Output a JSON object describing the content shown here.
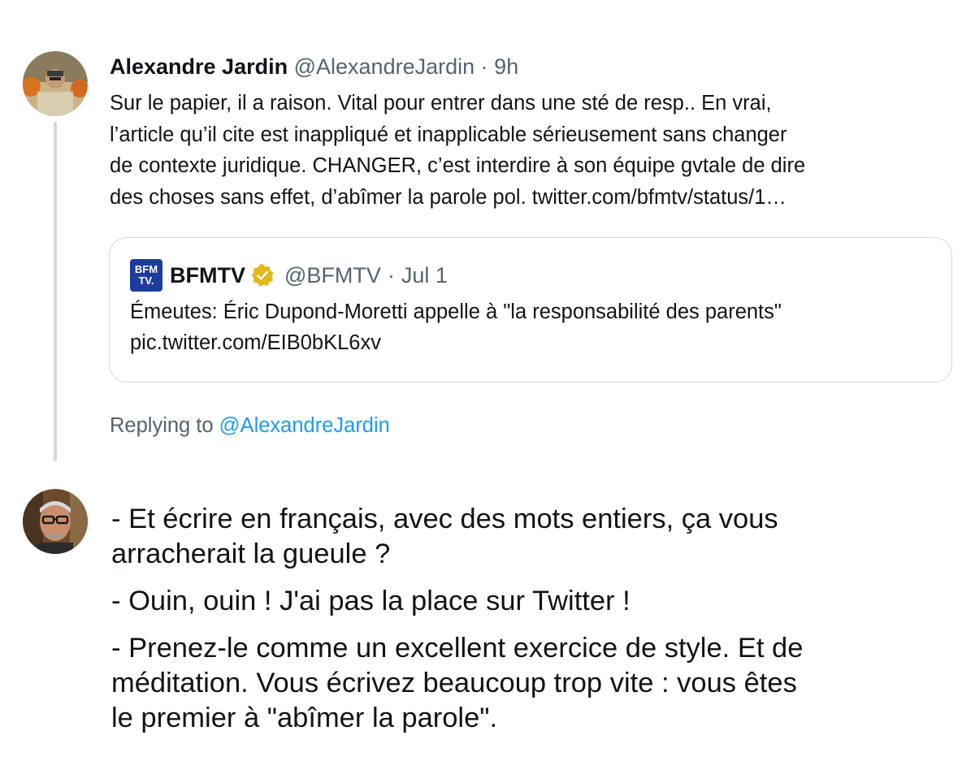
{
  "original_tweet": {
    "author_name": "Alexandre Jardin",
    "handle": "@AlexandreJardin",
    "separator": "·",
    "time": "9h",
    "avatar_icon": "user-photo-avatar",
    "text_lines": [
      "Sur le papier, il a raison. Vital pour entrer dans une sté de resp.. En vrai,",
      "l’article qu’il cite est inappliqué et inapplicable sérieusement sans changer",
      "de contexte juridique. CHANGER, c’est interdire à son équipe gvtale de dire",
      "des choses sans effet, d’abîmer la parole pol. twitter.com/bfmtv/status/1…"
    ]
  },
  "quoted_tweet": {
    "logo_text": [
      "BFM",
      "TV."
    ],
    "author_name": "BFMTV",
    "verified_icon": "gold-verified-badge-icon",
    "handle": "@BFMTV",
    "separator": "·",
    "time": "Jul 1",
    "text_lines": [
      "Émeutes: Éric Dupond-Moretti appelle à \"la responsabilité des parents\"",
      "pic.twitter.com/EIB0bKL6xv"
    ]
  },
  "replying_to": {
    "prefix": "Replying to",
    "mention": "@AlexandreJardin"
  },
  "reply": {
    "avatar_icon": "user-photo-avatar",
    "paragraphs": [
      [
        "- Et écrire en français, avec des mots entiers, ça vous",
        "arracherait la gueule ?"
      ],
      [
        "- Ouin, ouin ! J'ai pas la place sur Twitter !"
      ],
      [
        "- Prenez-le comme un excellent exercice de style. Et de",
        "méditation. Vous écrivez beaucoup trop vite : vous êtes",
        "le premier à \"abîmer la parole\"."
      ]
    ]
  },
  "colors": {
    "text_primary": "#0f1419",
    "text_secondary": "#536471",
    "link": "#1d9bf0",
    "border": "#cfd9de",
    "verified_gold": "#e2b719",
    "bfm_blue": "#1c3c9c"
  }
}
